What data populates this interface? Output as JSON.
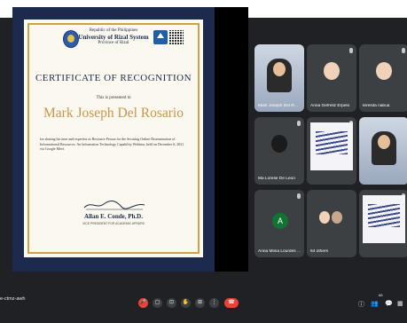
{
  "certificate": {
    "header_line1": "Republic of the Philippines",
    "header_line2": "University of Rizal System",
    "header_line3": "Province of Rizal",
    "title": "CERTIFICATE OF RECOGNITION",
    "presented_to": "This is presented to",
    "recipient": "Mark Joseph Del Rosario",
    "body": "for sharing his time and expertise as Resource Person for the Securing Online Dissemination of Informational Resources: An Information Technology Capability Webinar, held on December 6, 2021 via Google Meet.",
    "signer": "Allan E. Conde, Ph.D.",
    "signer_role": "VICE PRESIDENT FOR ACADEMIC AFFAIRS"
  },
  "participants": [
    {
      "name": "Mark Joseph Del R...",
      "type": "webcam"
    },
    {
      "name": "Anna Gefreliz Erpelo",
      "type": "avatar"
    },
    {
      "name": "teresita nabua",
      "type": "avatar"
    },
    {
      "name": "Ma Lorelie De Leon",
      "type": "avatar"
    },
    {
      "name": "",
      "type": "slide"
    },
    {
      "name": "",
      "type": "webcam"
    },
    {
      "name": "Anna Minia Lourdes ...",
      "type": "letter",
      "letter": "A"
    },
    {
      "name": "64 others",
      "type": "others"
    },
    {
      "name": "",
      "type": "slide"
    }
  ],
  "meeting": {
    "code": "e-ctmz-awh",
    "people_count": "68"
  },
  "controls": [
    "mic-off",
    "camera",
    "captions",
    "raise-hand",
    "present",
    "more",
    "end-call"
  ],
  "colors": {
    "accent_red": "#ea4335",
    "bg": "#202124",
    "tile": "#3c4043",
    "avatar_green": "#137333"
  }
}
